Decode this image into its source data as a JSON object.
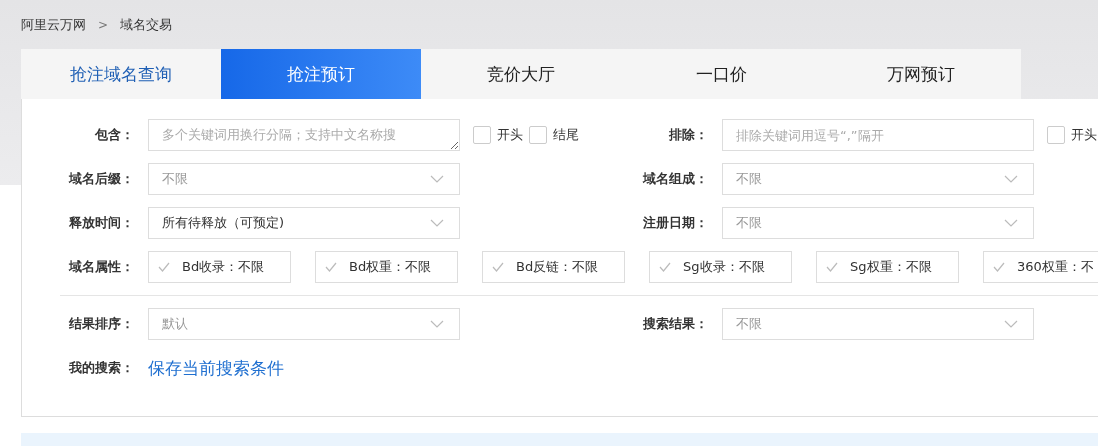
{
  "breadcrumb": [
    {
      "label": "阿里云万网"
    },
    {
      "label": "域名交易"
    }
  ],
  "breadcrumb_separator": ">",
  "tabs": [
    {
      "label": "抢注域名查询",
      "selected": false,
      "kind": "link"
    },
    {
      "label": "抢注预订",
      "selected": true,
      "kind": "tab"
    },
    {
      "label": "竞价大厅",
      "selected": false,
      "kind": "tab"
    },
    {
      "label": "一口价",
      "selected": false,
      "kind": "tab"
    },
    {
      "label": "万网预订",
      "selected": false,
      "kind": "tab"
    }
  ],
  "form": {
    "rows": [
      {
        "kind": "pair",
        "fields": [
          {
            "label": "包含：",
            "kind": "textarea",
            "placeholder": "多个关键词用换行分隔；支持中文名称搜",
            "checkboxes": [
              {
                "label": "开头",
                "checked": false
              },
              {
                "label": "结尾",
                "checked": false
              }
            ]
          },
          {
            "label": "排除：",
            "kind": "text",
            "placeholder": "排除关键词用逗号“,”隔开",
            "checkboxes": [
              {
                "label": "开头",
                "checked": false
              }
            ]
          }
        ]
      },
      {
        "kind": "pair",
        "fields": [
          {
            "label": "域名后缀：",
            "kind": "select",
            "value": "不限",
            "muted": true
          },
          {
            "label": "域名组成：",
            "kind": "select",
            "value": "不限",
            "muted": true
          }
        ]
      },
      {
        "kind": "pair",
        "fields": [
          {
            "label": "释放时间：",
            "kind": "select",
            "value": "所有待释放（可预定)",
            "muted": false
          },
          {
            "label": "注册日期：",
            "kind": "select",
            "value": "不限",
            "muted": true
          }
        ]
      },
      {
        "kind": "chips",
        "label": "域名属性：",
        "chips": [
          "Bd收录：不限",
          "Bd权重：不限",
          "Bd反链：不限",
          "Sg收录：不限",
          "Sg权重：不限",
          "360权重：不"
        ]
      },
      {
        "kind": "divider"
      },
      {
        "kind": "pair",
        "fields": [
          {
            "label": "结果排序：",
            "kind": "select",
            "value": "默认",
            "muted": true
          },
          {
            "label": "搜索结果：",
            "kind": "select",
            "value": "不限",
            "muted": true
          }
        ]
      },
      {
        "kind": "link",
        "label": "我的搜索：",
        "link": "保存当前搜索条件"
      }
    ]
  }
}
